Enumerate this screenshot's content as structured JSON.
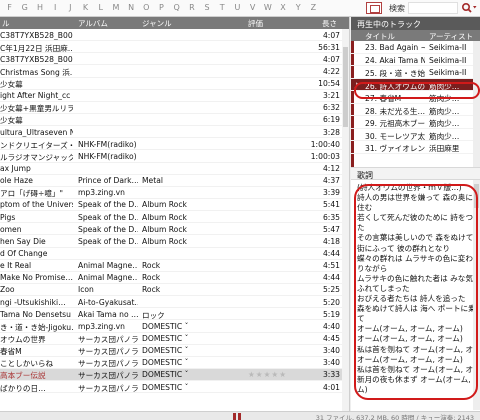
{
  "alphabet": [
    "F",
    "G",
    "H",
    "I",
    "J",
    "K",
    "L",
    "M",
    "N",
    "O",
    "P",
    "Q",
    "R",
    "S",
    "T",
    "U",
    "V",
    "W",
    "X",
    "Y",
    "Z"
  ],
  "search": {
    "label": "検索",
    "value": ""
  },
  "colors": {
    "accent": "#7a1e1e",
    "highlight_ring": "#d11a1a",
    "header": "#7a7a7a"
  },
  "library": {
    "columns": {
      "title": "ル",
      "album": "アルバム",
      "genre": "ジャンル",
      "rating": "評価",
      "length": "長さ"
    },
    "rows": [
      {
        "title": "C38T7YXB528_B00M…",
        "album": "",
        "genre": "",
        "rating": "",
        "length": "4:07"
      },
      {
        "title": "C年1月22日 浜田麻…",
        "album": "",
        "genre": "",
        "rating": "",
        "length": "56:31"
      },
      {
        "title": "C38T7YXB528_B00M…",
        "album": "",
        "genre": "",
        "rating": "",
        "length": "4:07"
      },
      {
        "title": "Christmas Song 浜…",
        "album": "",
        "genre": "",
        "rating": "",
        "length": "4:22"
      },
      {
        "title": "少女幕",
        "album": "",
        "genre": "",
        "rating": "",
        "length": "10:54"
      },
      {
        "title": "ight After Night_cc",
        "album": "",
        "genre": "",
        "rating": "",
        "length": "3:21"
      },
      {
        "title": "少女幕+黒童男ルリヲ",
        "album": "",
        "genre": "",
        "rating": "",
        "length": "6:32"
      },
      {
        "title": "少女幕",
        "album": "",
        "genre": "",
        "rating": "",
        "length": "6:19"
      },
      {
        "title": "ultura_Ultraseven N…",
        "album": "",
        "genre": "",
        "rating": "",
        "length": "3:28"
      },
      {
        "title": "ンドクリエイターズ・ファイ…",
        "album": "NHK-FM(radiko)",
        "genre": "",
        "rating": "",
        "length": "1:00:40"
      },
      {
        "title": "ルラジオマンジャック20…",
        "album": "NHK-FM(radiko)",
        "genre": "",
        "rating": "",
        "length": "1:00:03"
      },
      {
        "title": "ax Jump",
        "album": "",
        "genre": "",
        "rating": "",
        "length": "4:12"
      },
      {
        "title": "ole Haze",
        "album": "Prince of Dark…",
        "genre": "Metal",
        "rating": "",
        "length": "4:37"
      },
      {
        "title": "アロ「げ碍÷噫」\"",
        "album": "mp3.zing.vn",
        "genre": "",
        "rating": "",
        "length": "3:39"
      },
      {
        "title": "ptom of the Universe",
        "album": "Speak of the D…",
        "genre": "Album Rock",
        "rating": "",
        "length": "5:41"
      },
      {
        "title": "Pigs",
        "album": "Speak of the D…",
        "genre": "Album Rock",
        "rating": "",
        "length": "6:35"
      },
      {
        "title": "omen",
        "album": "Speak of the D…",
        "genre": "Album Rock",
        "rating": "",
        "length": "5:47"
      },
      {
        "title": "hen Say Die",
        "album": "Speak of the D…",
        "genre": "Album Rock",
        "rating": "",
        "length": "4:18"
      },
      {
        "title": "d Of Change",
        "album": "",
        "genre": "",
        "rating": "",
        "length": "4:44"
      },
      {
        "title": "e It Real",
        "album": "Animal Magne…",
        "genre": "Rock",
        "rating": "",
        "length": "4:51"
      },
      {
        "title": "Make No Promise…",
        "album": "Animal Magne…",
        "genre": "Rock",
        "rating": "",
        "length": "4:44"
      },
      {
        "title": "Zoo",
        "album": "Icon",
        "genre": "Rock",
        "rating": "",
        "length": "5:25"
      },
      {
        "title": "ngi -Utsukishiki…",
        "album": "Ai-to-Gyakusat…",
        "genre": "",
        "rating": "",
        "length": "5:20"
      },
      {
        "title": "Tama No Densetsu",
        "album": "Akai Tama no …",
        "genre": "ロック",
        "rating": "",
        "length": "5:19"
      },
      {
        "title": "き・道・き始-Jigoku…",
        "album": "mp3.zing.vn",
        "genre": "DOMESTIC ˇ",
        "rating": "",
        "length": "4:40"
      },
      {
        "title": "オウムの世界",
        "album": "サーカス団パノラ…",
        "genre": "DOMESTIC ˇ",
        "rating": "",
        "length": "4:45"
      },
      {
        "title": "春省M",
        "album": "サーカス団パノラ…",
        "genre": "DOMESTIC ˇ",
        "rating": "",
        "length": "3:40"
      },
      {
        "title": "ことしかいらね",
        "album": "サーカス団パノラ…",
        "genre": "DOMESTIC ˇ",
        "rating": "",
        "length": "3:40"
      },
      {
        "title": "高本ブー伝説",
        "album": "サーカス団パノラ…",
        "genre": "DOMESTIC ˇ",
        "rating": "★★★★★",
        "length": "3:33",
        "current": true
      },
      {
        "title": "ばかりの日…",
        "album": "サーカス団パノラ…",
        "genre": "DOMESTIC ˇ",
        "rating": "",
        "length": "4:01"
      }
    ]
  },
  "now_playing": {
    "header": "再生中のトラック",
    "columns": {
      "title": "タイトル",
      "artist": "アーティスト"
    },
    "rows": [
      {
        "title": "23. Bad Again ~…",
        "artist": "Seikima-II"
      },
      {
        "title": "24. Akai Tama N…",
        "artist": "Seikima-II"
      },
      {
        "title": "25. 段・道・き始…",
        "artist": "Seikima-II"
      },
      {
        "title": "26. 詩人オウムの…",
        "artist": "筋肉少…",
        "active": true
      },
      {
        "title": "27. 春省M",
        "artist": "筋肉少…"
      },
      {
        "title": "28. 未だ光る生…",
        "artist": "筋肉少…"
      },
      {
        "title": "29. 元祖高木ブー…",
        "artist": "筋肉少…"
      },
      {
        "title": "30. モーレツア太郎",
        "artist": "筋肉少…"
      },
      {
        "title": "31. ヴァイオレンス…",
        "artist": "浜田麻里"
      }
    ],
    "note_icon": "♪"
  },
  "lyrics": {
    "header": "歌詞",
    "lines": [
      "(詩人オウムの世界・ｍｖ版…)",
      "詩人の男は世界を嫌って 森の奥に",
      "住む",
      "若くして死んだ彼のために 詩をつづっ",
      "た",
      "その言葉は美しいので 森をぬけて",
      "街にふって 彼の群れとなり",
      "蝶々の群れは ムラサキの色に変わ",
      "りながら",
      "ムラサキの色に触れた者は みな気が",
      "ふれてしまった",
      "おびえる者たちは 詩人を追った",
      "森をぬけて詩人は 海へ ポートに乗っ",
      "て",
      "オーム(オーム, オーム, オーム)",
      "オーム(オーム, オーム, オーム)",
      "私は首を刎ねて オーム(オーム, オーム)",
      "オーム(オーム, オーム, オーム)",
      "私は首を刎ねて オーム(オーム, オーム)",
      "新月の夜も休まず オーム(オーム, オー",
      "ム)"
    ]
  },
  "status": {
    "text": "31 ファイル, 637.2 MB, 60 時間 / キュー演奏: 2143"
  }
}
